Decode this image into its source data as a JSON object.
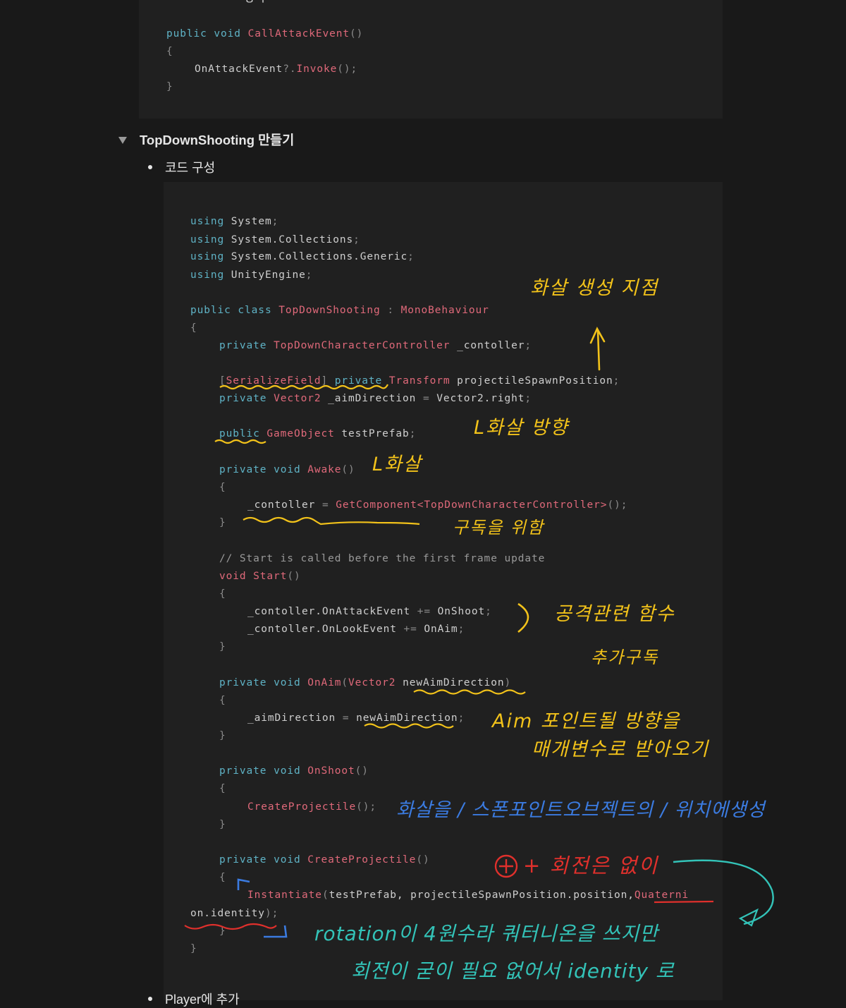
{
  "top_code": {
    "fragment": "방식",
    "l1": [
      "public",
      "void",
      "CallAttackEvent",
      "()"
    ],
    "l2": "{",
    "l3": [
      "OnAttackEvent",
      "?.",
      "Invoke",
      "();"
    ],
    "l4": "}"
  },
  "section": {
    "toggle_title": "TopDownShooting 만들기",
    "bullet_code": "코드 구성",
    "bullet_player": "Player에 추가"
  },
  "code": {
    "using": "using",
    "ns1": "System",
    "ns2": "System.Collections",
    "ns3": "System.Collections.Generic",
    "ns4": "UnityEngine",
    "public": "public",
    "class": "class",
    "private": "private",
    "void": "void",
    "class_name": "TopDownShooting",
    "base_class": "MonoBehaviour",
    "controller_type": "TopDownCharacterController",
    "controller_field": "_contoller",
    "serialize_field": "SerializeField",
    "transform": "Transform",
    "spawn_pos": "projectileSpawnPosition",
    "vector2": "Vector2",
    "aim_dir": "_aimDirection",
    "vector2_right": "Vector2.right",
    "gameobject": "GameObject",
    "test_prefab": "testPrefab",
    "awake": "Awake",
    "get_component": "GetComponent<TopDownCharacterController>",
    "comment": "// Start is called before the first frame update",
    "start": "Start",
    "on_attack_event": "_contoller.OnAttackEvent",
    "plus_eq": "+=",
    "on_shoot": "OnShoot",
    "on_look_event": "_contoller.OnLookEvent",
    "on_aim": "OnAim",
    "new_aim_dir": "newAimDirection",
    "create_projectile": "CreateProjectile",
    "instantiate": "Instantiate",
    "inst_args": "testPrefab, projectileSpawnPosition.position,",
    "quaterni": "Quaterni",
    "on_identity": "on.identity",
    "open_brace": "{",
    "close_brace": "}",
    "semi": ";",
    "eq": "=",
    "colon": ":",
    "parens": "()",
    "parens_semi": "();",
    "open_paren": "(",
    "close_paren": ")",
    "close_paren_semi": ");",
    "open_bracket": "[",
    "close_bracket": "]"
  },
  "annotations": {
    "spawn_point": "화살 생성 지점",
    "arrow_direction": "L화살 방향",
    "arrow": "L화살",
    "component_get": "구독을 위함",
    "attack_func": "공격관련 함수",
    "attack_func_2": "추가구독",
    "aim_point_1": "Aim 포인트될 방향을",
    "aim_point_2": "매개변수로 받아오기",
    "create_arrow": "화살을 / 스폰포인트오브젝트의 / 위치에생성",
    "no_rotation": "+ 회전은 없이",
    "rotation_1": "rotation이 4원수라 쿼터니온을 쓰지만",
    "rotation_2": "회전이 굳이 필요 없어서 identity 로"
  },
  "colors": {
    "background": "#191919",
    "code_background": "#202020",
    "keyword": "#5fb3c6",
    "type": "#e0697a",
    "annotation_yellow": "#f2c21a",
    "annotation_blue": "#3b7be0",
    "annotation_teal": "#33c3b8",
    "annotation_red": "#e0302c"
  }
}
